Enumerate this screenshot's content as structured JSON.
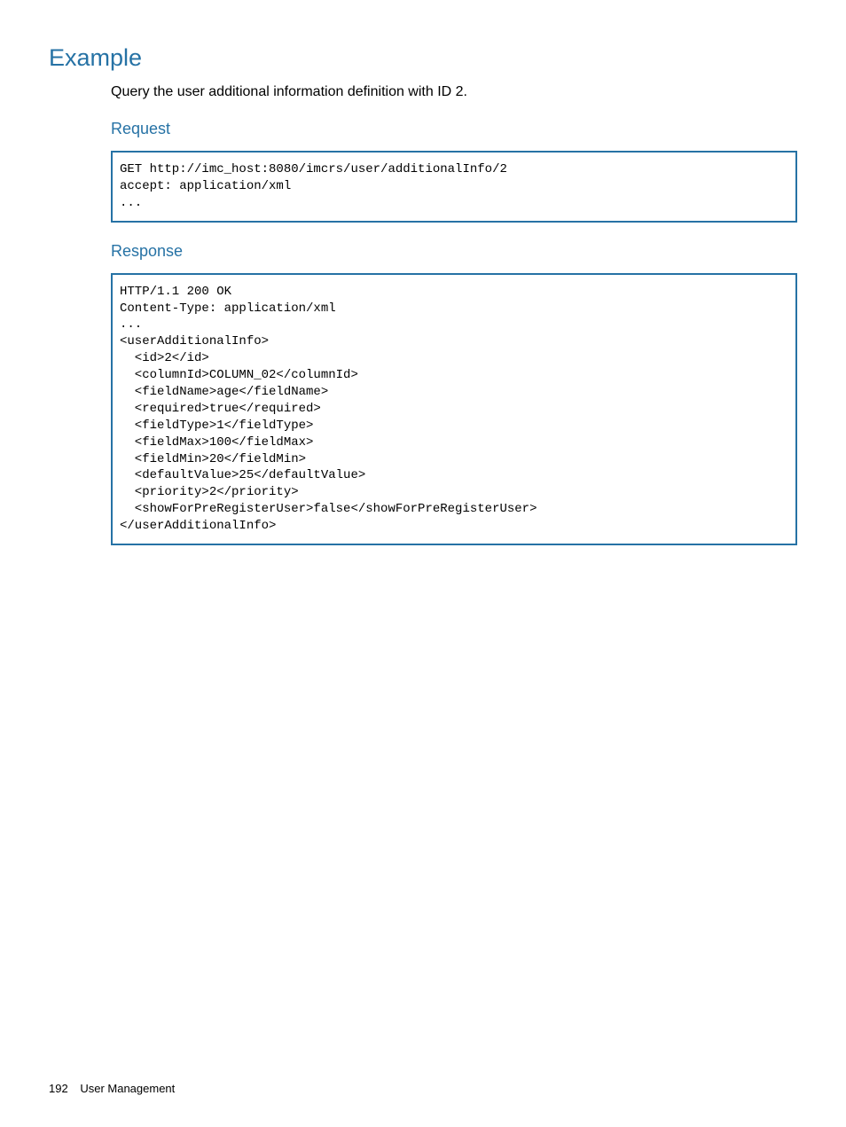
{
  "headings": {
    "example": "Example",
    "request": "Request",
    "response": "Response"
  },
  "intro": "Query the user additional information definition with ID 2.",
  "code": {
    "request": "GET http://imc_host:8080/imcrs/user/additionalInfo/2\naccept: application/xml\n...",
    "response": "HTTP/1.1 200 OK\nContent-Type: application/xml\n...\n<userAdditionalInfo>\n  <id>2</id>\n  <columnId>COLUMN_02</columnId>\n  <fieldName>age</fieldName>\n  <required>true</required>\n  <fieldType>1</fieldType>\n  <fieldMax>100</fieldMax>\n  <fieldMin>20</fieldMin>\n  <defaultValue>25</defaultValue>\n  <priority>2</priority>\n  <showForPreRegisterUser>false</showForPreRegisterUser>\n</userAdditionalInfo>"
  },
  "footer": {
    "page_number": "192",
    "section": "User Management"
  }
}
